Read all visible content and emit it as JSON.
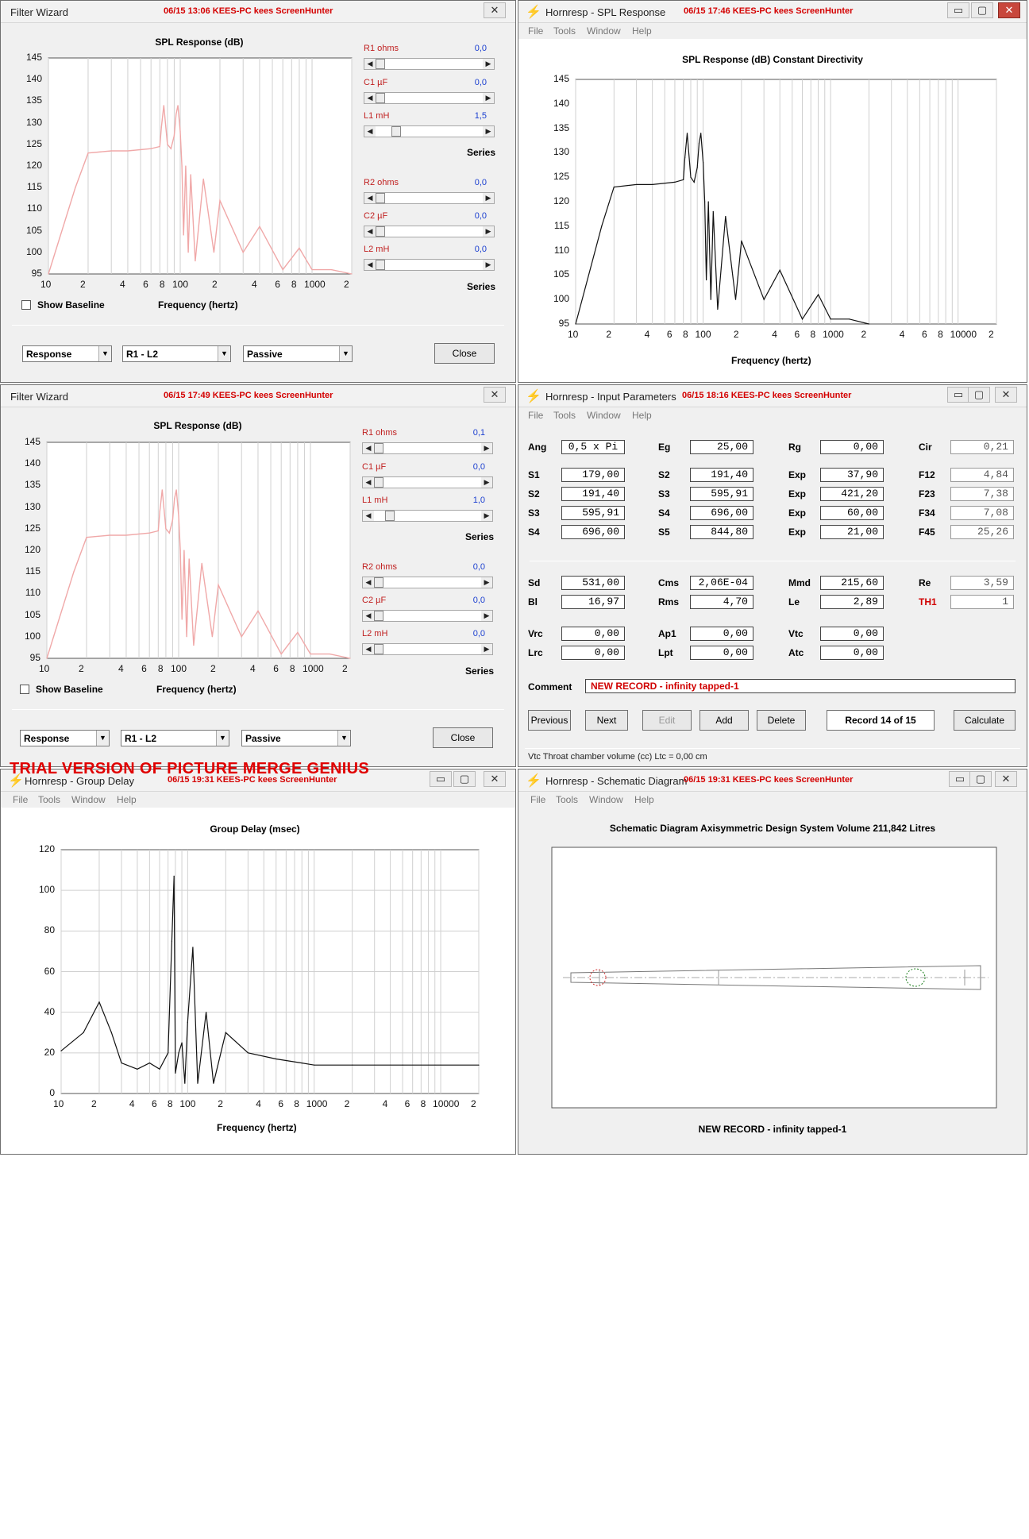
{
  "trial_banner": "TRIAL VERSION OF PICTURE MERGE GENIUS",
  "fw1": {
    "title": "Filter Wizard",
    "stamp": "06/15 13:06 KEES-PC kees ScreenHunter",
    "close_glyph": "✕",
    "chart_title": "SPL Response (dB)",
    "xlabel": "Frequency (hertz)",
    "yticks": [
      "145",
      "140",
      "135",
      "130",
      "125",
      "120",
      "115",
      "110",
      "105",
      "100",
      "95"
    ],
    "xticks": [
      "10",
      "2",
      "4",
      "6",
      "8",
      "100",
      "2",
      "4",
      "6",
      "8",
      "1000",
      "2"
    ],
    "sliders": [
      {
        "label": "R1  ohms",
        "value": "0,0",
        "thumb": 0
      },
      {
        "label": "C1  µF",
        "value": "0,0",
        "thumb": 0
      },
      {
        "label": "L1  mH",
        "value": "1,5",
        "thumb": 0.15
      },
      {
        "label": "R2  ohms",
        "value": "0,0",
        "thumb": 0
      },
      {
        "label": "C2  µF",
        "value": "0,0",
        "thumb": 0
      },
      {
        "label": "L2  mH",
        "value": "0,0",
        "thumb": 0
      }
    ],
    "series1": "Series",
    "series2": "Series",
    "show_baseline": "Show Baseline",
    "combo1": "Response",
    "combo2": "R1 - L2",
    "combo3": "Passive",
    "close": "Close"
  },
  "fw2": {
    "title": "Filter Wizard",
    "stamp": "06/15 17:49 KEES-PC kees ScreenHunter",
    "close_glyph": "✕",
    "chart_title": "SPL Response (dB)",
    "xlabel": "Frequency (hertz)",
    "sliders": [
      {
        "label": "R1  ohms",
        "value": "0,1",
        "thumb": 0
      },
      {
        "label": "C1  µF",
        "value": "0,0",
        "thumb": 0
      },
      {
        "label": "L1  mH",
        "value": "1,0",
        "thumb": 0.1
      },
      {
        "label": "R2  ohms",
        "value": "0,0",
        "thumb": 0
      },
      {
        "label": "C2  µF",
        "value": "0,0",
        "thumb": 0
      },
      {
        "label": "L2  mH",
        "value": "0,0",
        "thumb": 0
      }
    ],
    "series1": "Series",
    "series2": "Series",
    "show_baseline": "Show Baseline",
    "combo1": "Response",
    "combo2": "R1 - L2",
    "combo3": "Passive",
    "close": "Close"
  },
  "spl": {
    "title": "Hornresp - SPL Response",
    "stamp": "06/15 17:46 KEES-PC kees ScreenHunter",
    "menu": [
      "File",
      "Tools",
      "Window",
      "Help"
    ],
    "chart_title": "SPL Response (dB)   Constant Directivity",
    "xlabel": "Frequency (hertz)",
    "yticks": [
      "145",
      "140",
      "135",
      "130",
      "125",
      "120",
      "115",
      "110",
      "105",
      "100",
      "95"
    ],
    "xticks": [
      "10",
      "2",
      "4",
      "6",
      "8",
      "100",
      "2",
      "4",
      "6",
      "8",
      "1000",
      "2",
      "4",
      "6",
      "8",
      "10000",
      "2"
    ]
  },
  "inp": {
    "title": "Hornresp - Input Parameters",
    "stamp": "06/15 18:16 KEES-PC kees ScreenHunter",
    "menu": [
      "File",
      "Tools",
      "Window",
      "Help"
    ],
    "rows": [
      [
        [
          "Ang",
          "0,5 x Pi"
        ],
        [
          "Eg",
          "25,00"
        ],
        [
          "Rg",
          "0,00"
        ],
        [
          "Cir",
          "0,21"
        ]
      ],
      [
        [
          "S1",
          "179,00"
        ],
        [
          "S2",
          "191,40"
        ],
        [
          "Exp",
          "37,90"
        ],
        [
          "F12",
          "4,84"
        ]
      ],
      [
        [
          "S2",
          "191,40"
        ],
        [
          "S3",
          "595,91"
        ],
        [
          "Exp",
          "421,20"
        ],
        [
          "F23",
          "7,38"
        ]
      ],
      [
        [
          "S3",
          "595,91"
        ],
        [
          "S4",
          "696,00"
        ],
        [
          "Exp",
          "60,00"
        ],
        [
          "F34",
          "7,08"
        ]
      ],
      [
        [
          "S4",
          "696,00"
        ],
        [
          "S5",
          "844,80"
        ],
        [
          "Exp",
          "21,00"
        ],
        [
          "F45",
          "25,26"
        ]
      ],
      [
        [
          "Sd",
          "531,00"
        ],
        [
          "Cms",
          "2,06E-04"
        ],
        [
          "Mmd",
          "215,60"
        ],
        [
          "Re",
          "3,59"
        ]
      ],
      [
        [
          "Bl",
          "16,97"
        ],
        [
          "Rms",
          "4,70"
        ],
        [
          "Le",
          "2,89"
        ],
        [
          "TH1",
          "1"
        ]
      ],
      [
        [
          "Vrc",
          "0,00"
        ],
        [
          "Ap1",
          "0,00"
        ],
        [
          "Vtc",
          "0,00"
        ]
      ],
      [
        [
          "Lrc",
          "0,00"
        ],
        [
          "Lpt",
          "0,00"
        ],
        [
          "Atc",
          "0,00"
        ]
      ]
    ],
    "comment_label": "Comment",
    "comment": "NEW RECORD - infinity tapped-1",
    "buttons": [
      "Previous",
      "Next",
      "Edit",
      "Add",
      "Delete"
    ],
    "record": "Record 14 of 15",
    "calculate": "Calculate",
    "status": "Vtc   Throat chamber volume  (cc)   Ltc = 0,00 cm"
  },
  "gd": {
    "title": "Hornresp - Group Delay",
    "stamp": "06/15 19:31 KEES-PC kees ScreenHunter",
    "menu": [
      "File",
      "Tools",
      "Window",
      "Help"
    ],
    "chart_title": "Group Delay (msec)",
    "xlabel": "Frequency (hertz)",
    "yticks": [
      "120",
      "100",
      "80",
      "60",
      "40",
      "20",
      "0"
    ],
    "xticks": [
      "10",
      "2",
      "4",
      "6",
      "8",
      "100",
      "2",
      "4",
      "6",
      "8",
      "1000",
      "2",
      "4",
      "6",
      "8",
      "10000",
      "2"
    ]
  },
  "sch": {
    "title": "Hornresp - Schematic Diagram",
    "stamp": "06/15 19:31 KEES-PC kees ScreenHunter",
    "menu": [
      "File",
      "Tools",
      "Window",
      "Help"
    ],
    "heading": "Schematic Diagram   Axisymmetric Design   System Volume 211,842 Litres",
    "caption": "NEW RECORD - infinity tapped-1"
  },
  "win_glyphs": {
    "min": "▭",
    "max": "▢",
    "close": "✕"
  },
  "chart_data": [
    {
      "type": "line",
      "title": "SPL Response (dB)",
      "xlabel": "Frequency (hertz)",
      "x_scale": "log",
      "xlim": [
        10,
        2000
      ],
      "ylim": [
        95,
        145
      ],
      "series": [
        {
          "x": [
            10,
            16,
            20,
            30,
            40,
            60,
            70,
            72,
            75,
            80,
            85,
            90,
            93,
            96,
            100,
            103,
            106,
            110,
            115,
            120,
            130,
            150,
            180,
            200,
            300,
            400,
            600,
            800,
            1000,
            1400,
            2000
          ],
          "y": [
            95,
            115,
            123,
            123.5,
            123.5,
            124,
            124.5,
            129,
            134,
            125,
            124,
            127,
            132,
            134,
            128,
            120,
            104,
            120,
            100,
            118,
            98,
            117,
            100,
            112,
            100,
            106,
            96,
            101,
            96,
            96,
            95
          ]
        }
      ]
    },
    {
      "type": "line",
      "title": "SPL Response (dB)   Constant Directivity",
      "xlabel": "Frequency (hertz)",
      "x_scale": "log",
      "xlim": [
        10,
        20000
      ],
      "ylim": [
        95,
        145
      ],
      "series": [
        {
          "x": [
            10,
            16,
            20,
            30,
            40,
            60,
            70,
            72,
            75,
            80,
            85,
            90,
            93,
            96,
            100,
            103,
            106,
            110,
            115,
            120,
            130,
            150,
            180,
            200,
            300,
            400,
            600,
            800,
            1000,
            1400,
            2000
          ],
          "y": [
            95,
            115,
            123,
            123.5,
            123.5,
            124,
            124.5,
            129,
            134,
            125,
            124,
            127,
            132,
            134,
            128,
            120,
            104,
            120,
            100,
            118,
            98,
            117,
            100,
            112,
            100,
            106,
            96,
            101,
            96,
            96,
            95
          ]
        }
      ]
    },
    {
      "type": "line",
      "title": "Group Delay (msec)",
      "xlabel": "Frequency (hertz)",
      "x_scale": "log",
      "xlim": [
        10,
        20000
      ],
      "ylim": [
        0,
        120
      ],
      "series": [
        {
          "x": [
            10,
            15,
            20,
            25,
            30,
            40,
            50,
            60,
            70,
            75,
            78,
            80,
            85,
            90,
            95,
            100,
            110,
            120,
            140,
            160,
            200,
            300,
            500,
            800,
            1000,
            2000,
            5000,
            20000
          ],
          "y": [
            21,
            30,
            45,
            30,
            15,
            12,
            15,
            12,
            20,
            75,
            107,
            10,
            20,
            25,
            5,
            35,
            72,
            5,
            40,
            5,
            30,
            20,
            17,
            15,
            14,
            14,
            14,
            14
          ]
        }
      ]
    }
  ]
}
